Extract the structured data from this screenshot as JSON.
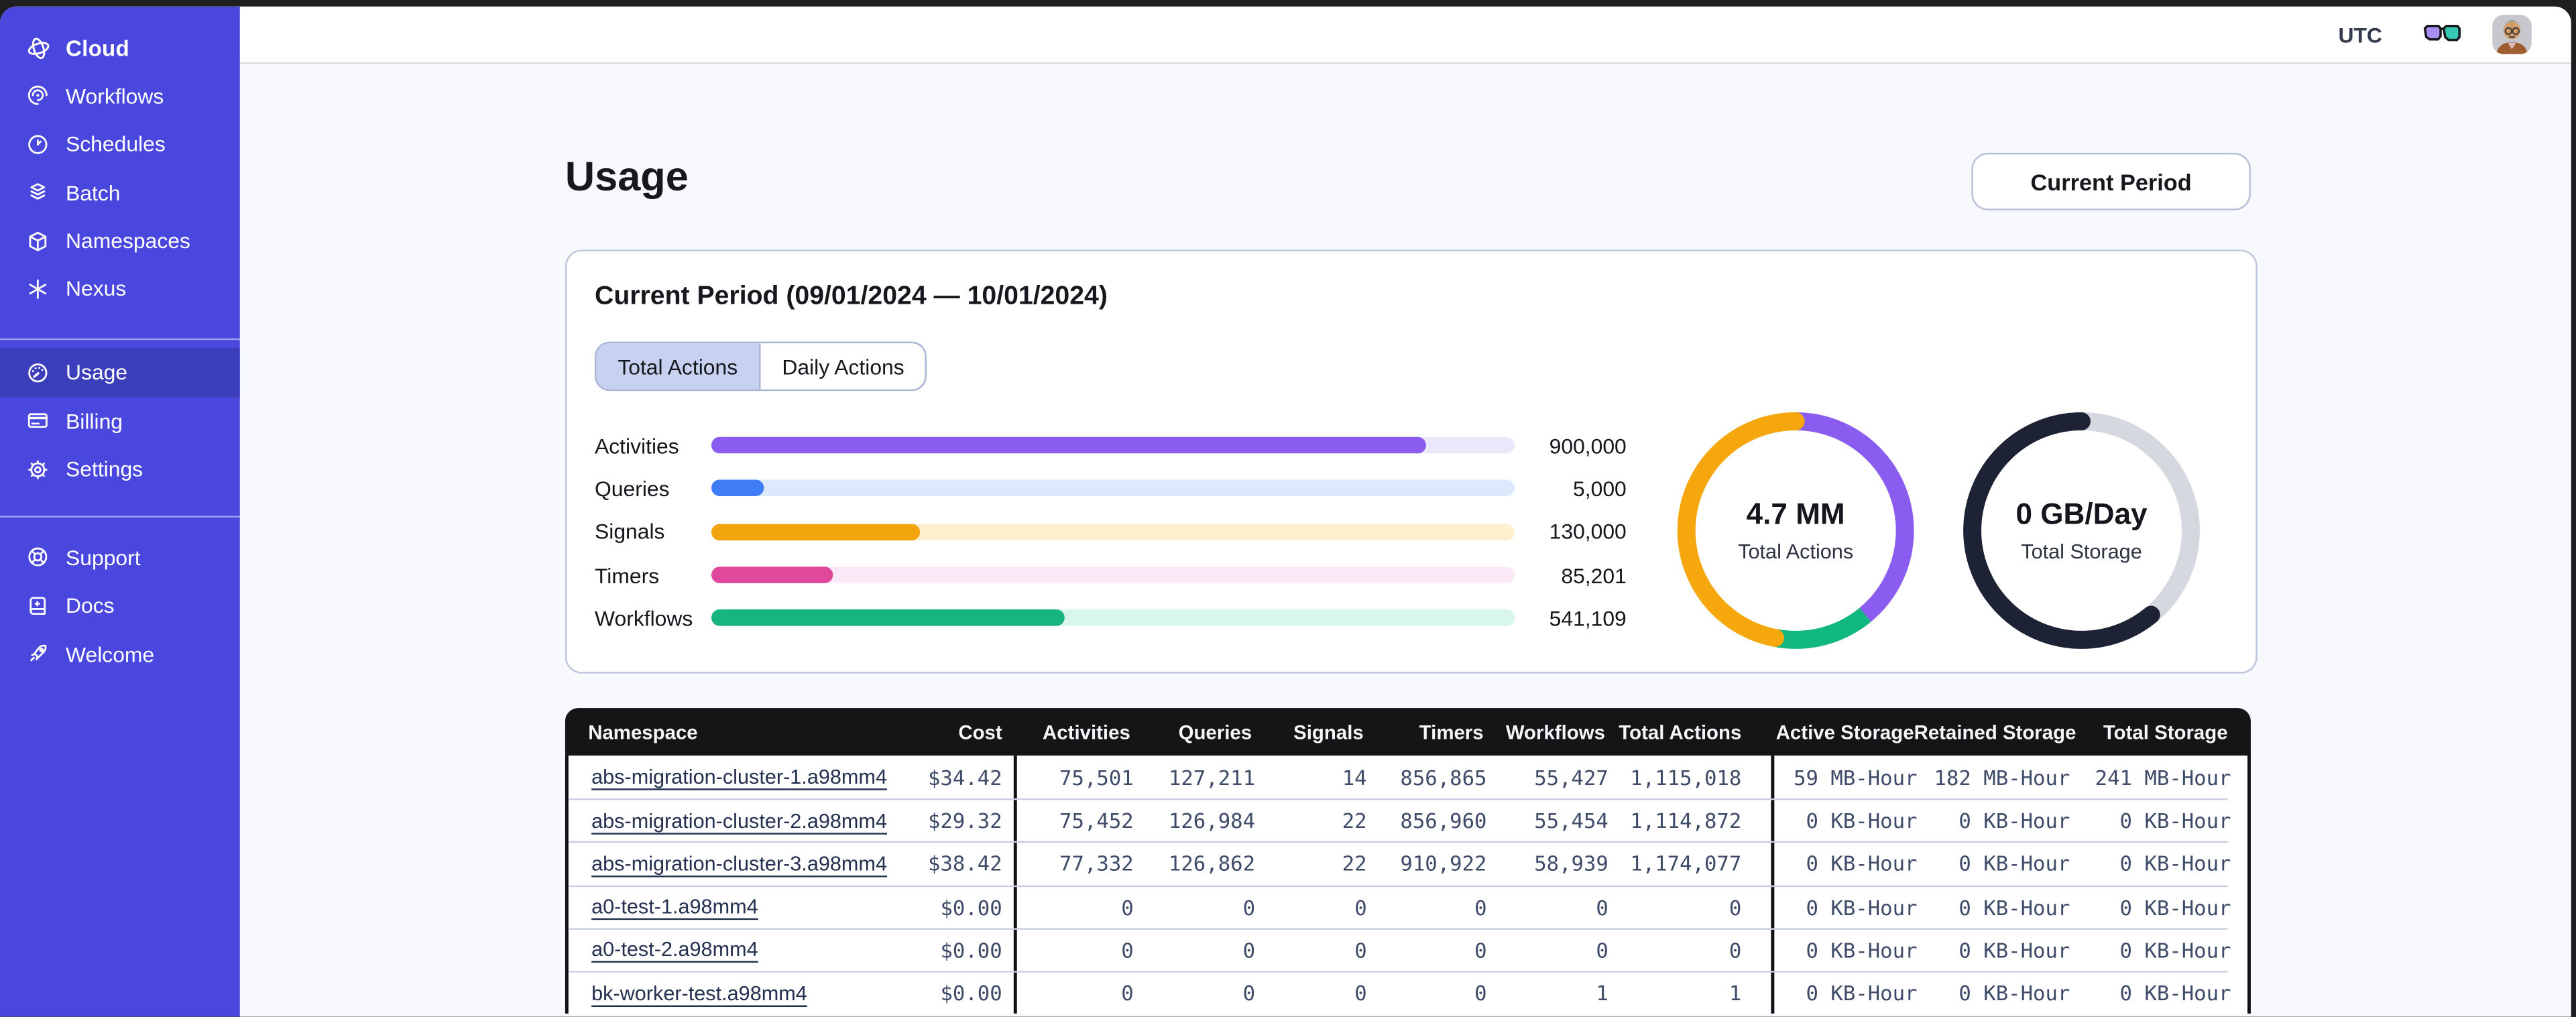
{
  "sidebar": {
    "logo": "Cloud",
    "collapse_icon": "chevron-left-icon",
    "groups": [
      [
        {
          "label": "Workflows",
          "icon": "workflows-icon"
        },
        {
          "label": "Schedules",
          "icon": "schedules-icon"
        },
        {
          "label": "Batch",
          "icon": "batch-icon"
        },
        {
          "label": "Namespaces",
          "icon": "namespaces-icon"
        },
        {
          "label": "Nexus",
          "icon": "nexus-icon"
        }
      ],
      [
        {
          "label": "Usage",
          "icon": "usage-icon",
          "active": true
        },
        {
          "label": "Billing",
          "icon": "billing-icon"
        },
        {
          "label": "Settings",
          "icon": "settings-icon"
        }
      ],
      [
        {
          "label": "Support",
          "icon": "support-icon"
        },
        {
          "label": "Docs",
          "icon": "docs-icon"
        },
        {
          "label": "Welcome",
          "icon": "welcome-icon"
        }
      ]
    ],
    "colors": {
      "bg": "#4947de",
      "active_bg": "#3b3eba"
    }
  },
  "topbar": {
    "timezone": "UTC",
    "icons": [
      "clock-icon",
      "chevron-down-icon",
      "glasses-icon",
      "avatar",
      "chevron-down-icon"
    ]
  },
  "page": {
    "title": "Usage",
    "period_button": "Current Period"
  },
  "card": {
    "title": "Current Period (09/01/2024 — 10/01/2024)",
    "tabs": [
      {
        "label": "Total Actions",
        "active": true
      },
      {
        "label": "Daily Actions",
        "active": false
      }
    ]
  },
  "chart_data": [
    {
      "type": "bar",
      "orientation": "horizontal",
      "categories": [
        "Activities",
        "Queries",
        "Signals",
        "Timers",
        "Workflows"
      ],
      "values": [
        900000,
        5000,
        130000,
        85201,
        541109
      ],
      "value_labels": [
        "900,000",
        "5,000",
        "130,000",
        "85,201",
        "541,109"
      ],
      "fill_pct": [
        89,
        6.6,
        26,
        15.2,
        44
      ],
      "colors": [
        "#8b5cf0",
        "#3f7df6",
        "#f2a50c",
        "#e0489b",
        "#17b381"
      ],
      "track_colors": [
        "#ece8fb",
        "#dce8fb",
        "#fcf0cf",
        "#fce9f7",
        "#d9f6ea"
      ],
      "title": "",
      "xlabel": "",
      "ylabel": "",
      "grid": false,
      "legend": false
    },
    {
      "type": "pie",
      "label": "4.7 MM",
      "sublabel": "Total Actions",
      "segments": [
        {
          "name": "activities",
          "pct": 39,
          "color": "#8b5cf0",
          "cap": false
        },
        {
          "name": "workflows",
          "pct": 14,
          "color": "#10b77e",
          "cap": false
        },
        {
          "name": "signals",
          "pct": 47,
          "color": "#f5a70d",
          "cap": true
        }
      ]
    },
    {
      "type": "pie",
      "label": "0 GB/Day",
      "sublabel": "Total Storage",
      "segments": [
        {
          "name": "free",
          "pct": 39,
          "color": "#d6d8df",
          "cap": false
        },
        {
          "name": "used",
          "pct": 61,
          "color": "#1e2235",
          "cap": true
        }
      ]
    }
  ],
  "table": {
    "columns": [
      "Namespace",
      "Cost",
      "Activities",
      "Queries",
      "Signals",
      "Timers",
      "Workflows",
      "Total Actions",
      "Active Storage",
      "Retained Storage",
      "Total Storage"
    ],
    "rows": [
      [
        "abs-migration-cluster-1.a98mm4",
        "$34.42",
        "75,501",
        "127,211",
        "14",
        "856,865",
        "55,427",
        "1,115,018",
        "59 MB-Hour",
        "182 MB-Hour",
        "241 MB-Hour"
      ],
      [
        "abs-migration-cluster-2.a98mm4",
        "$29.32",
        "75,452",
        "126,984",
        "22",
        "856,960",
        "55,454",
        "1,114,872",
        "0 KB-Hour",
        "0 KB-Hour",
        "0 KB-Hour"
      ],
      [
        "abs-migration-cluster-3.a98mm4",
        "$38.42",
        "77,332",
        "126,862",
        "22",
        "910,922",
        "58,939",
        "1,174,077",
        "0 KB-Hour",
        "0 KB-Hour",
        "0 KB-Hour"
      ],
      [
        "a0-test-1.a98mm4",
        "$0.00",
        "0",
        "0",
        "0",
        "0",
        "0",
        "0",
        "0 KB-Hour",
        "0 KB-Hour",
        "0 KB-Hour"
      ],
      [
        "a0-test-2.a98mm4",
        "$0.00",
        "0",
        "0",
        "0",
        "0",
        "0",
        "0",
        "0 KB-Hour",
        "0 KB-Hour",
        "0 KB-Hour"
      ],
      [
        "bk-worker-test.a98mm4",
        "$0.00",
        "0",
        "0",
        "0",
        "0",
        "1",
        "1",
        "0 KB-Hour",
        "0 KB-Hour",
        "0 KB-Hour"
      ]
    ]
  }
}
